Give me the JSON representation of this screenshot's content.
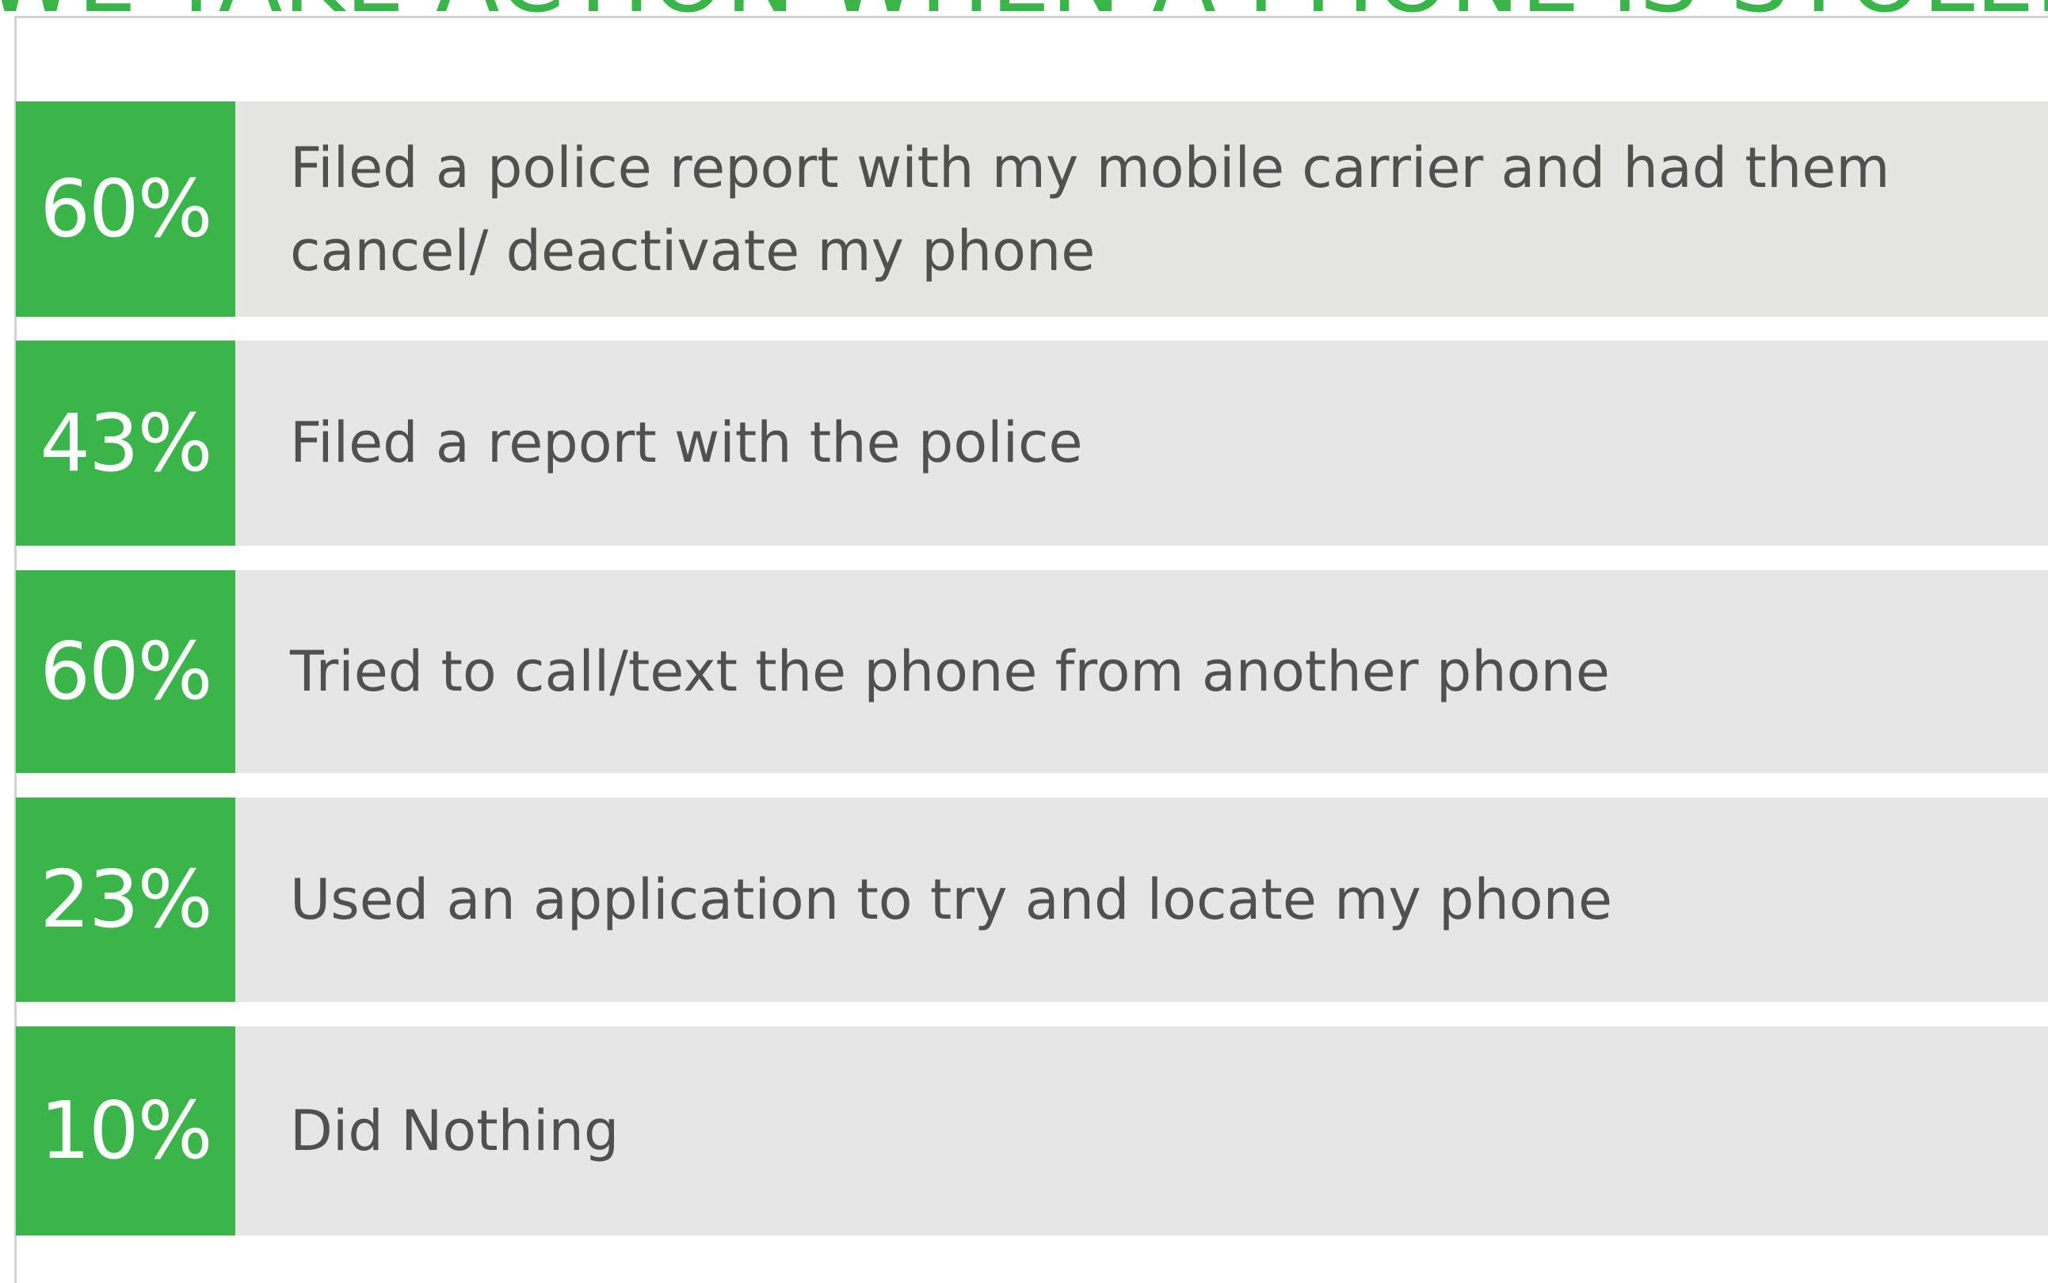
{
  "header": {
    "title": "WE TAKE ACTION WHEN A PHONE IS STOLEN:"
  },
  "colors": {
    "accent": "#3ab54a",
    "row_background": "#e6e6e6",
    "label_text": "#505050",
    "badge_text": "#ffffff"
  },
  "chart_data": {
    "type": "table",
    "title": "WE TAKE ACTION WHEN A PHONE IS STOLEN:",
    "rows": [
      {
        "value": 60,
        "value_label": "60%",
        "label": "Filed a police report with my mobile carrier and had them cancel/ deactivate my phone"
      },
      {
        "value": 43,
        "value_label": "43%",
        "label": "Filed a report with the police"
      },
      {
        "value": 60,
        "value_label": "60%",
        "label": "Tried to call/text the phone from another phone"
      },
      {
        "value": 23,
        "value_label": "23%",
        "label": "Used an application to try and locate my phone"
      },
      {
        "value": 10,
        "value_label": "10%",
        "label": "Did Nothing"
      }
    ]
  }
}
